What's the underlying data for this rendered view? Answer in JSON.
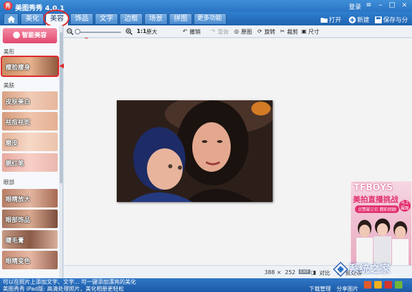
{
  "app": {
    "logo_char": "秀",
    "title": "美图秀秀 4.0.1",
    "login": "登录"
  },
  "window_controls": {
    "skin": "≡",
    "minimize": "–",
    "maximize": "□",
    "close": "×"
  },
  "tabs": [
    {
      "label": "美化"
    },
    {
      "label": "美容"
    },
    {
      "label": "饰品"
    },
    {
      "label": "文字"
    },
    {
      "label": "边框"
    },
    {
      "label": "场景"
    },
    {
      "label": "拼图"
    }
  ],
  "more_tab": "更多功能 ▾",
  "toolbar_right": {
    "open": "打开",
    "new": "新建",
    "save": "保存与分享"
  },
  "sidebar": {
    "smart_button": "智能美容",
    "sections": {
      "shape": "美形",
      "skin": "美肤",
      "eyes": "眼部"
    },
    "items": {
      "slim": "瘦脸瘦身",
      "skin_whiten": "皮肤美白",
      "acne": "祛痘祛斑",
      "smooth": "磨皮",
      "blush": "腮红笔",
      "eye_enlarge": "眼睛放大",
      "eye_deco": "眼部饰品",
      "lash": "睫毛膏",
      "eye_color": "眼睛变色"
    }
  },
  "actionbar": {
    "ratio": "1:1",
    "original": "原大",
    "undo": "撤销",
    "redo": "重做",
    "origin_img": "原图",
    "rotate": "旋转",
    "crop": "裁剪",
    "size": "尺寸"
  },
  "ad": {
    "title": "TFBOYS",
    "subtitle": "美拍直播挑战",
    "pill": "点赞破三亿 精彩回顾",
    "badge": "马上围观"
  },
  "infobar": {
    "width": "388",
    "x": "×",
    "height": "252",
    "contrast": "对比",
    "batch": "批处理"
  },
  "status": {
    "line1": "可以在照片上添加文字、文字... 可一键添加漂亮的美化",
    "line2": "美图秀秀 iPad版: 高清处理照片，美化相册更轻松",
    "download": "下载管理",
    "share": "分享图片"
  },
  "watermark": {
    "text": "系统之家",
    "sub": "XITONGZHIJIA.NET"
  },
  "colors": {
    "accent_blue": "#2a74c4",
    "annotation_red": "#e0282a",
    "smart_pink": "#e1486f"
  }
}
